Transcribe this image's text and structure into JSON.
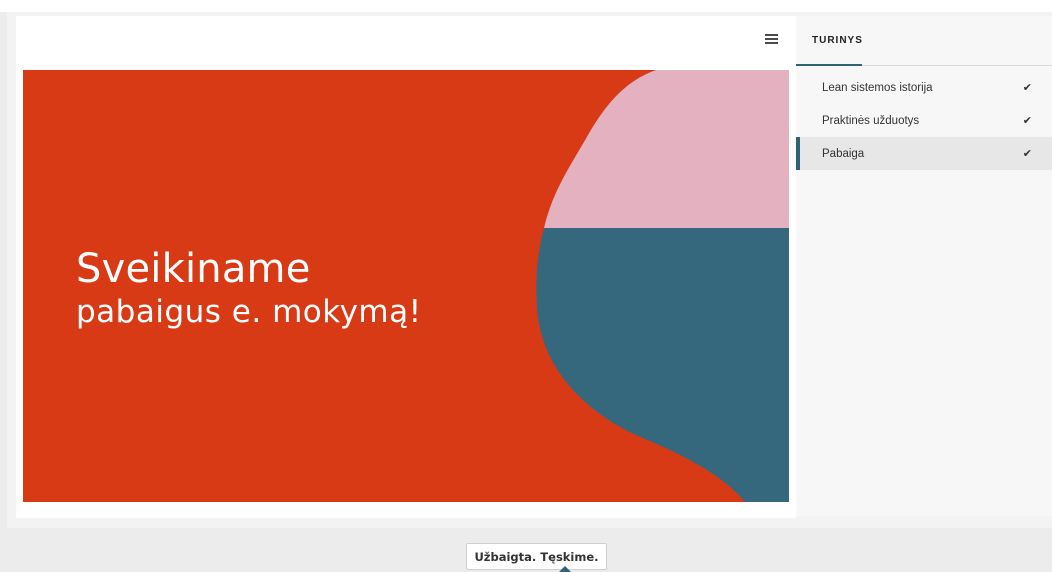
{
  "slide": {
    "heading": "Sveikiname",
    "subheading": "pabaigus e. mokymą!",
    "colors": {
      "background": "#d73a15",
      "pink": "#e4b1c1",
      "teal": "#35687c"
    }
  },
  "toolbar": {
    "menu_icon": "hamburger-menu-icon"
  },
  "toc": {
    "title": "TURINYS",
    "items": [
      {
        "label": "Lean sistemos istorija",
        "status": "✔",
        "active": false
      },
      {
        "label": "Praktinės užduotys",
        "status": "✔",
        "active": false
      },
      {
        "label": "Pabaiga",
        "status": "✔",
        "active": true
      }
    ]
  },
  "footer": {
    "continue_label": "Užbaigta. Tęskime."
  },
  "colors": {
    "accent": "#2e6276",
    "panel": "#f7f7f7",
    "active_row": "#e7e7e7"
  }
}
